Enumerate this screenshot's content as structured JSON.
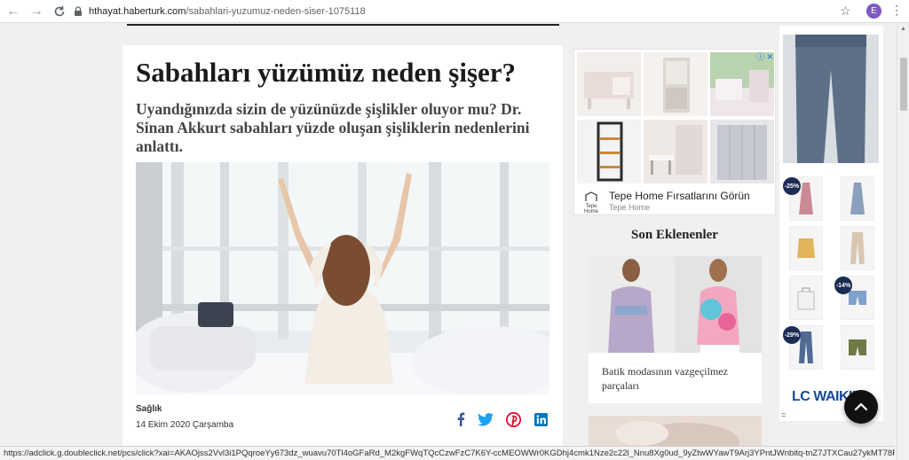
{
  "browser": {
    "url_host": "hthayat.haberturk.com",
    "url_path": "/sabahlari-yuzumuz-neden-siser-1075118",
    "profile_initial": "E",
    "status_url": "https://adclick.g.doubleclick.net/pcs/click?xai=AKAOjss2Vvl3i1PQqroeYy673dz_wuavu70Tl4oGFaRd_M2kgFWqTQcCzwFzC7K6Y-ccMEOWWr0KGDhj4cmk1Nze2c22l_Nnu8Xg0ud_9yZtwWYawT9Arj3YPntJWnbitq-tnZ7JTXCau27ykMT78F-Cufp1_1_OX8D..."
  },
  "article": {
    "title": "Sabahları yüzümüz neden şişer?",
    "subtitle": "Uyandığınızda sizin de yüzünüzde şişlikler oluyor mu? Dr. Sinan Akkurt sabahları yüzde oluşan şişliklerin nedenlerini anlattı.",
    "category": "Sağlık",
    "date": "14 Ekim 2020 Çarşamba",
    "share_icons": [
      "facebook-icon",
      "twitter-icon",
      "pinterest-icon",
      "linkedin-icon"
    ]
  },
  "ad": {
    "title": "Tepe Home Fırsatlarını Görün",
    "advertiser": "Tepe Home",
    "logo_text": "Tepe Home"
  },
  "sidebar": {
    "section_title": "Son Eklenenler",
    "card_text": "Batik modasının vazgeçilmez parçaları"
  },
  "rail_ad": {
    "discounts": [
      "-25%",
      "-14%",
      "-29%"
    ],
    "brand": "LC WAIKIKI",
    "footer_glyph": "="
  },
  "colors": {
    "brand_lcw": "#1a4a96",
    "facebook": "#3b5998",
    "twitter": "#1da1f2",
    "pinterest": "#e60023",
    "linkedin": "#0077b5"
  }
}
